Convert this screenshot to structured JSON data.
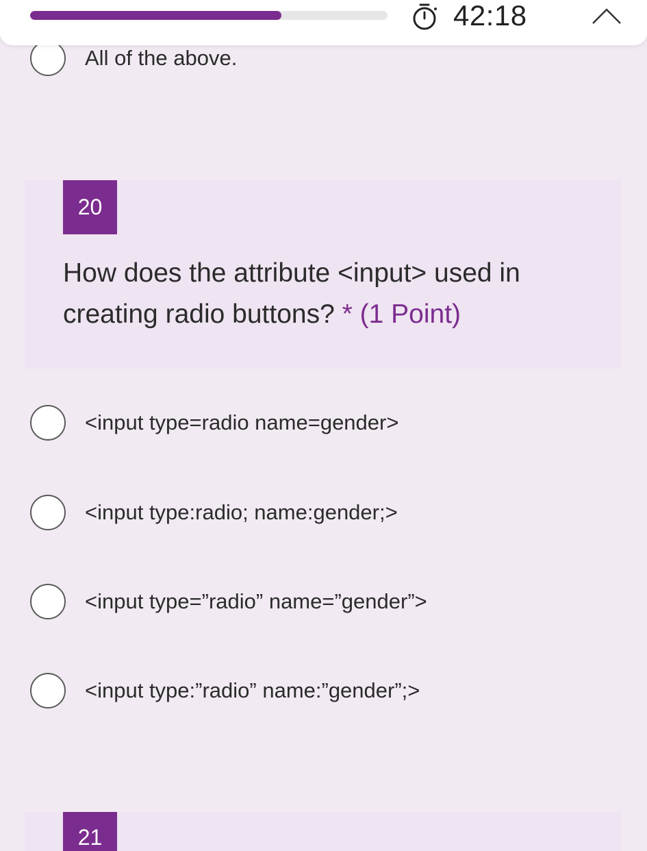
{
  "header": {
    "progress_fraction": 0.704,
    "timer": "42:18",
    "timer_icon": "stopwatch-icon",
    "collapse_icon": "chevron-up-icon"
  },
  "prev_question": {
    "last_option": "All of the above."
  },
  "question": {
    "number": "20",
    "text": "How does the attribute <input> used in creating radio buttons?",
    "required_mark": "*",
    "points": "(1 Point)",
    "options": [
      "<input type=radio name=gender>",
      "<input type:radio; name:gender;>",
      "<input type=”radio” name=”gender”>",
      "<input type:”radio” name:”gender”;>"
    ]
  },
  "next_question": {
    "number": "21"
  },
  "colors": {
    "accent": "#7b2c8f",
    "background": "#f1eaf2",
    "card": "#efe4f1"
  }
}
